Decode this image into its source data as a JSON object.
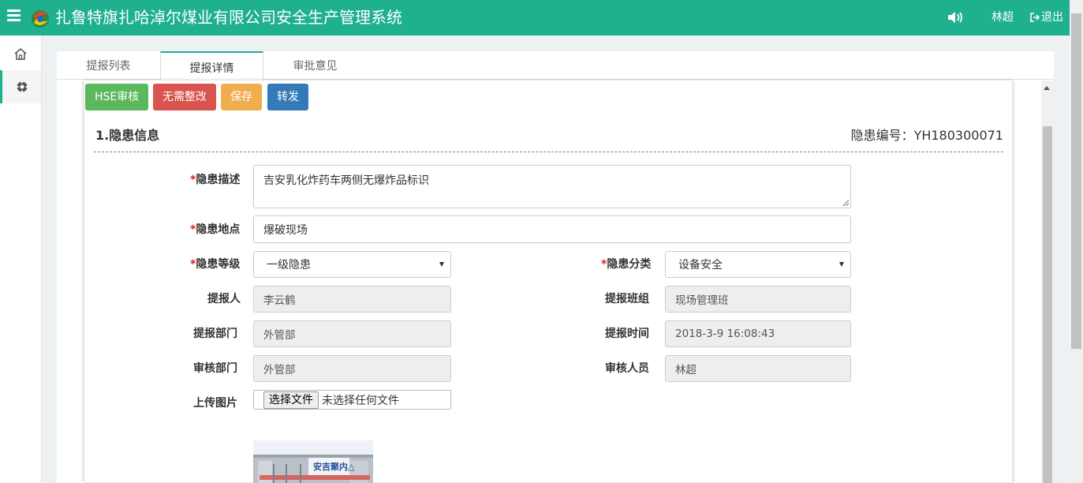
{
  "header": {
    "title": "扎鲁特旗扎哈淖尔煤业有限公司安全生产管理系统",
    "user": "林超",
    "logout_label": "退出"
  },
  "colors": {
    "brand": "#1fb08e",
    "success": "#5cb85c",
    "danger": "#d9534f",
    "warning": "#f0ad4e",
    "primary": "#337ab7",
    "required": "#e02020"
  },
  "sidebar": {
    "items": [
      {
        "icon": "home-icon"
      },
      {
        "icon": "gear-circle-icon",
        "active": true
      }
    ]
  },
  "tabs": [
    {
      "label": "提报列表",
      "active": false
    },
    {
      "label": "提报详情",
      "active": true
    },
    {
      "label": "审批意见",
      "active": false
    }
  ],
  "toolbar": {
    "hse_label": "HSE审核",
    "no_rectify_label": "无需整改",
    "save_label": "保存",
    "forward_label": "转发"
  },
  "section": {
    "title": "1.隐患信息",
    "hazard_no": "隐患编号：YH180300071"
  },
  "form": {
    "required_mark": "*",
    "description": {
      "label": "隐患描述",
      "value": "吉安乳化炸药车两侧无爆炸品标识"
    },
    "location": {
      "label": "隐患地点",
      "value": "爆破现场"
    },
    "level": {
      "label": "隐患等级",
      "value": "一级隐患"
    },
    "category": {
      "label": "隐患分类",
      "value": "设备安全"
    },
    "reporter": {
      "label": "提报人",
      "value": "李云鹤"
    },
    "team": {
      "label": "提报班组",
      "value": "现场管理班"
    },
    "department": {
      "label": "提报部门",
      "value": "外管部"
    },
    "report_time": {
      "label": "提报时间",
      "value": "2018-3-9 16:08:43"
    },
    "audit_department": {
      "label": "审核部门",
      "value": "外管部"
    },
    "auditor": {
      "label": "审核人员",
      "value": "林超"
    },
    "upload": {
      "label": "上传图片",
      "button_label": "选择文件",
      "status": "未选择任何文件"
    }
  },
  "photo": {
    "sign_text": "安吉聚内△"
  }
}
